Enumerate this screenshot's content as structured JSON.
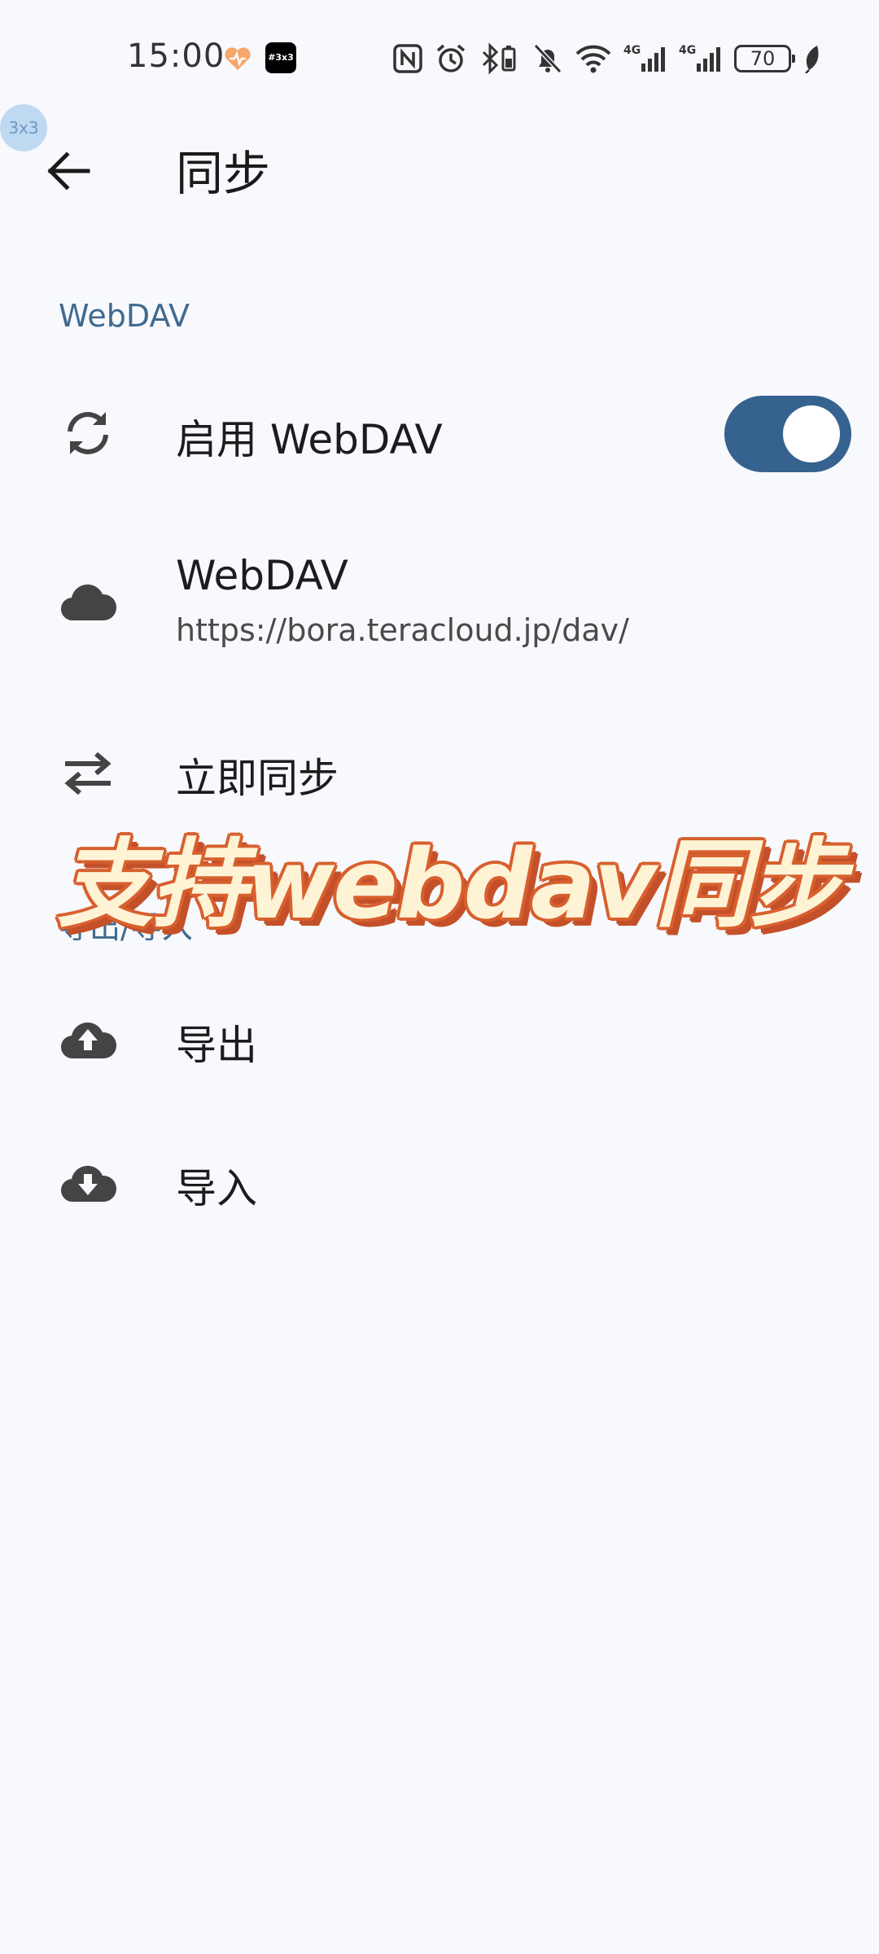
{
  "status_bar": {
    "time": "15:00",
    "app_badge": "#3x3",
    "battery": "70",
    "icons": [
      "nfc-icon",
      "alarm-icon",
      "bluetooth-battery-icon",
      "bell-off-icon",
      "wifi-icon",
      "signal-4g-icon",
      "signal-4g-icon",
      "battery-icon",
      "leaf-icon"
    ]
  },
  "floating_badge": "3x3",
  "app_bar": {
    "title": "同步"
  },
  "sections": {
    "webdav": {
      "header": "WebDAV",
      "enable": {
        "label": "启用 WebDAV",
        "enabled": true
      },
      "server": {
        "label": "WebDAV",
        "url": "https://bora.teracloud.jp/dav/"
      },
      "sync_now": {
        "label": "立即同步"
      }
    },
    "export_import": {
      "header": "导出/导入",
      "export": {
        "label": "导出"
      },
      "import": {
        "label": "导入"
      }
    }
  },
  "overlay_caption": "支持webdav同步",
  "colors": {
    "background": "#F7F9FD",
    "accent": "#35628F",
    "section_header": "#416A8F",
    "caption_fill": "#FFF3D6",
    "caption_stroke": "#D8602E"
  }
}
